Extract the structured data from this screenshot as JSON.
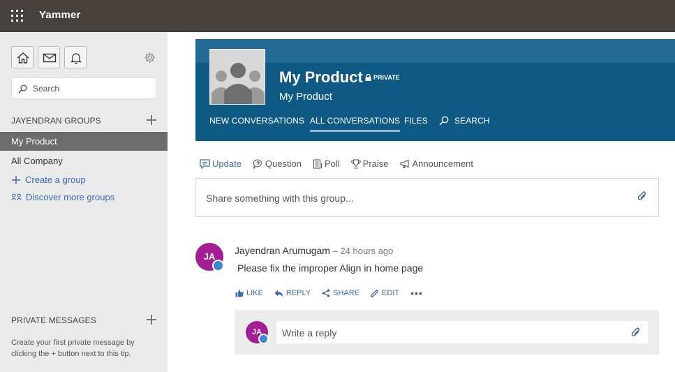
{
  "app": {
    "title": "Yammer"
  },
  "colors": {
    "topbar": "#46413d",
    "banner": "#0f5a85",
    "link": "#3b6bb4",
    "avatar": "#a51d95",
    "active_group": "#6c6c6c"
  },
  "sidebar": {
    "nav_icons": [
      "home-icon",
      "mail-icon",
      "bell-icon"
    ],
    "settings_icon": "gear-icon",
    "search": {
      "placeholder": "Search"
    },
    "groups_heading": "JAYENDRAN GROUPS",
    "groups": [
      {
        "label": "My Product",
        "active": true
      },
      {
        "label": "All Company",
        "active": false
      }
    ],
    "create_group": "Create a group",
    "discover_groups": "Discover more groups",
    "private_heading": "PRIVATE MESSAGES",
    "private_tip": "Create your first private message by clicking the + button next to this tip."
  },
  "group": {
    "name": "My Product",
    "privacy": "PRIVATE",
    "description": "My Product",
    "tabs": [
      {
        "label": "NEW CONVERSATIONS",
        "active": false
      },
      {
        "label": "ALL CONVERSATIONS",
        "active": true
      },
      {
        "label": "FILES",
        "active": false
      },
      {
        "label": "SEARCH",
        "active": false
      }
    ]
  },
  "composer": {
    "types": [
      "Update",
      "Question",
      "Poll",
      "Praise",
      "Announcement"
    ],
    "active_type": "Update",
    "placeholder": "Share something with this group..."
  },
  "post": {
    "initials": "JA",
    "author": "Jayendran Arumugam",
    "separator": " – ",
    "time": "24 hours ago",
    "body": "Please fix the improper Align in home page",
    "actions": [
      "LIKE",
      "REPLY",
      "SHARE",
      "EDIT"
    ],
    "more": "•••"
  },
  "reply": {
    "initials": "JA",
    "placeholder": "Write a reply"
  }
}
